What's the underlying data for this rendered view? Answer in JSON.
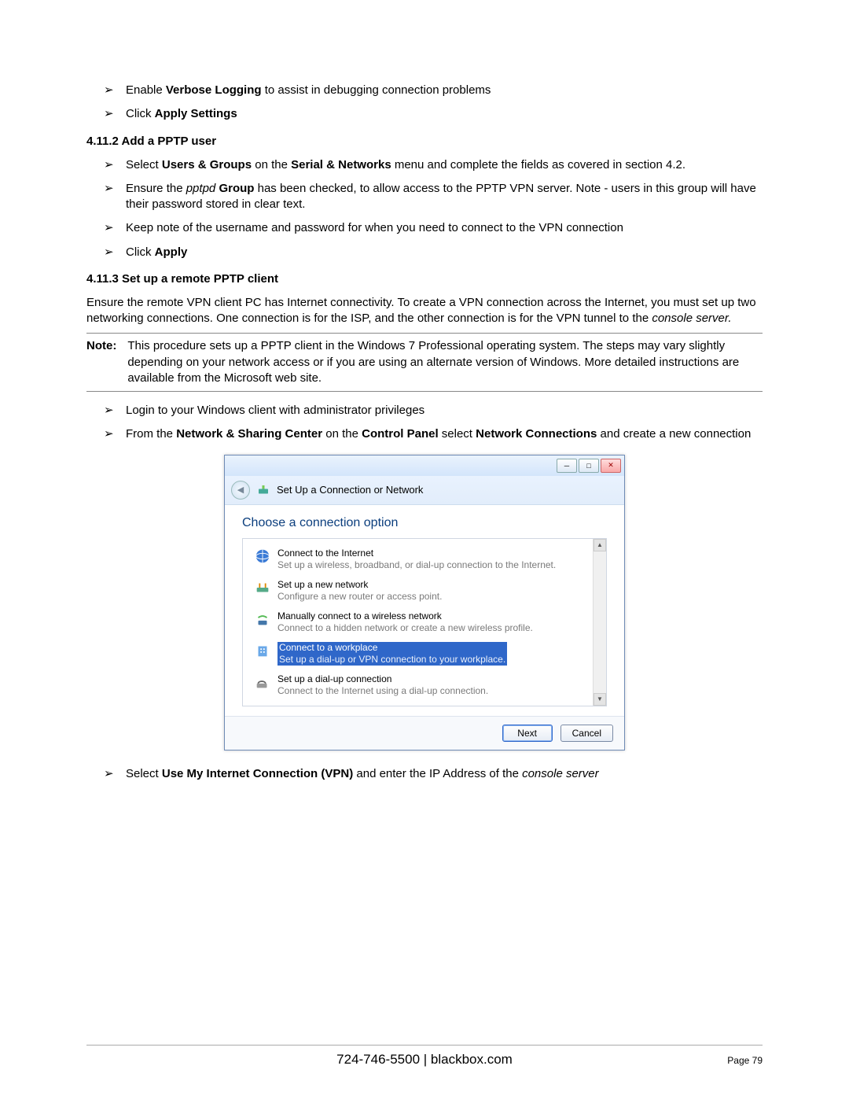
{
  "bullets_top": [
    {
      "pre": "Enable ",
      "bold": "Verbose Logging",
      "post": " to assist in debugging connection problems"
    },
    {
      "pre": "Click ",
      "bold": "Apply Settings",
      "post": ""
    }
  ],
  "heading1": "4.11.2  Add a PPTP user",
  "bullets_4112": [
    {
      "html": "Select <b>Users & Groups</b> on the <b>Serial & Networks</b> menu and complete the fields as covered in section 4.2."
    },
    {
      "html": "Ensure the <i>pptpd</i> <b>Group</b> has been checked, to allow access to the PPTP VPN server. Note - users in this group will have their password stored in clear text."
    },
    {
      "html": "Keep note of the username and password for when you need to connect to the VPN connection"
    },
    {
      "html": "Click <b>Apply</b>"
    }
  ],
  "heading2": "4.11.3  Set up a remote PPTP client",
  "para": "Ensure the remote VPN client PC has Internet connectivity. To create a VPN connection across the Internet, you must set up two networking connections. One connection is for the ISP, and the other connection is for the VPN tunnel to the ",
  "para_i": "console server.",
  "note_label": "Note:",
  "note_text": "This procedure sets up a PPTP client in the Windows 7 Professional operating system. The steps may vary slightly depending on your network access or if you are using an alternate version of Windows. More detailed instructions are available from the Microsoft web site.",
  "bullets_client": [
    {
      "html": "Login to your Windows client with administrator privileges"
    },
    {
      "html": "From the <b>Network & Sharing Center</b> on the <b>Control Panel</b> select <b>Network Connections</b> and create a new connection"
    }
  ],
  "dialog": {
    "title": "Set Up a Connection or Network",
    "prompt": "Choose a connection option",
    "options": [
      {
        "t": "Connect to the Internet",
        "s": "Set up a wireless, broadband, or dial-up connection to the Internet.",
        "sel": false,
        "icon": "globe"
      },
      {
        "t": "Set up a new network",
        "s": "Configure a new router or access point.",
        "sel": false,
        "icon": "router"
      },
      {
        "t": "Manually connect to a wireless network",
        "s": "Connect to a hidden network or create a new wireless profile.",
        "sel": false,
        "icon": "wifi"
      },
      {
        "t": "Connect to a workplace",
        "s": "Set up a dial-up or VPN connection to your workplace.",
        "sel": true,
        "icon": "building"
      },
      {
        "t": "Set up a dial-up connection",
        "s": "Connect to the Internet using a dial-up connection.",
        "sel": false,
        "icon": "phone"
      }
    ],
    "next": "Next",
    "cancel": "Cancel"
  },
  "bullets_after": [
    {
      "html": "Select <b>Use My Internet Connection (VPN)</b> and enter the IP Address of the <i>console server</i>"
    }
  ],
  "footer_center": "724-746-5500 | blackbox.com",
  "footer_page": "Page 79"
}
